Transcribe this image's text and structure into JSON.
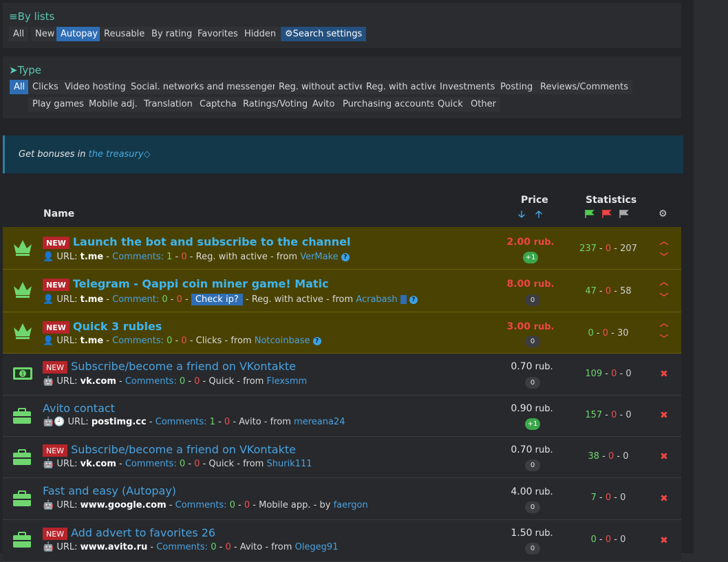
{
  "lists_panel": {
    "title": "By lists",
    "tabs": [
      "All",
      "New",
      "Autopay",
      "Reusable",
      "By rating",
      "Favorites",
      "Hidden"
    ],
    "active_tab": "Autopay",
    "search_label": "Search settings"
  },
  "type_panel": {
    "title": "Type",
    "row1": [
      "All",
      "Clicks",
      "Video hosting",
      "Social. networks and messengers",
      "Reg. without active",
      "Reg. with active",
      "Investments",
      "Posting",
      "Reviews/Comments"
    ],
    "row2": [
      "Play games",
      "Mobile adj.",
      "Translation",
      "Captcha",
      "Ratings/Voting",
      "Avito",
      "Purchasing accounts",
      "Quick",
      "Other"
    ],
    "active": "All"
  },
  "notice": {
    "prefix": "Get bonuses in ",
    "link": "the treasury"
  },
  "table": {
    "col_name": "Name",
    "col_price": "Price",
    "col_stats": "Statistics",
    "new_label": "NEW",
    "rub": "rub.",
    "check_ip": "Check ip?",
    "rows": [
      {
        "vip": true,
        "is_new": true,
        "icon": "crown-icon",
        "title": "Launch the bot and subscribe to the channel",
        "url_label": "URL:",
        "url": "t.me",
        "comments_label": "Comments:",
        "c1": "1",
        "c2": "0",
        "category": "Reg. with active",
        "from_label": "from",
        "user": "VerMake",
        "price": "2.00",
        "pill": "+1",
        "s1": "237",
        "s2": "0",
        "s3": "207",
        "device": "person-icon"
      },
      {
        "vip": true,
        "is_new": true,
        "icon": "crown-icon",
        "title": "Telegram - Qappi coin miner game! Matic",
        "url_label": "URL:",
        "url": "t.me",
        "comments_label": "Comment:",
        "c1": "0",
        "c2": "0",
        "category": "Reg. with active",
        "from_label": "from",
        "user": "Acrabash",
        "price": "8.00",
        "pill": "0",
        "s1": "47",
        "s2": "0",
        "s3": "58",
        "device": "person-icon"
      },
      {
        "vip": true,
        "is_new": true,
        "icon": "crown-icon",
        "title": "Quick 3 rubles",
        "url_label": "URL:",
        "url": "t.me",
        "comments_label": "Comments:",
        "c1": "0",
        "c2": "0",
        "category": "Clicks",
        "from_label": "from",
        "user": "Notcoinbase",
        "price": "3.00",
        "pill": "0",
        "s1": "0",
        "s2": "0",
        "s3": "30",
        "device": "person-icon"
      },
      {
        "vip": false,
        "is_new": true,
        "icon": "money-icon",
        "title": "Subscribe/become a friend on VKontakte",
        "url_label": "URL:",
        "url": "vk.com",
        "comments_label": "Comments:",
        "c1": "0",
        "c2": "0",
        "category": "Quick",
        "from_label": "from",
        "user": "Flexsmm",
        "price": "0.70",
        "pill": "0",
        "s1": "109",
        "s2": "0",
        "s3": "0",
        "device": "android-icon"
      },
      {
        "vip": false,
        "is_new": false,
        "icon": "briefcase-icon",
        "title": "Avito contact",
        "url_label": "URL:",
        "url": "postimg.cc",
        "comments_label": "Comments:",
        "c1": "1",
        "c2": "0",
        "category": "Avito",
        "from_label": "from",
        "user": "mereana24",
        "price": "0.90",
        "pill": "+1",
        "s1": "157",
        "s2": "0",
        "s3": "0",
        "device": "android-clock-icon"
      },
      {
        "vip": false,
        "is_new": true,
        "icon": "briefcase-icon",
        "title": "Subscribe/become a friend on VKontakte",
        "url_label": "URL:",
        "url": "vk.com",
        "comments_label": "Comments:",
        "c1": "0",
        "c2": "0",
        "category": "Quick",
        "from_label": "from",
        "user": "Shurik111",
        "price": "0.70",
        "pill": "0",
        "s1": "38",
        "s2": "0",
        "s3": "0",
        "device": "android-icon"
      },
      {
        "vip": false,
        "is_new": false,
        "icon": "briefcase-icon",
        "title": "Fast and easy (Autopay)",
        "url_label": "URL:",
        "url": "www.google.com",
        "comments_label": "Comments:",
        "c1": "0",
        "c2": "0",
        "category": "Mobile app.",
        "from_label": "by",
        "user": "faergon",
        "price": "4.00",
        "pill": "0",
        "s1": "7",
        "s2": "0",
        "s3": "0",
        "device": "android-icon"
      },
      {
        "vip": false,
        "is_new": true,
        "icon": "briefcase-icon",
        "title": "Add advert to favorites 26",
        "url_label": "URL:",
        "url": "www.avito.ru",
        "comments_label": "Comments:",
        "c1": "0",
        "c2": "0",
        "category": "Avito",
        "from_label": "from",
        "user": "Olegeg91",
        "price": "1.50",
        "pill": "0",
        "s1": "0",
        "s2": "0",
        "s3": "0",
        "device": "android-icon"
      }
    ]
  }
}
